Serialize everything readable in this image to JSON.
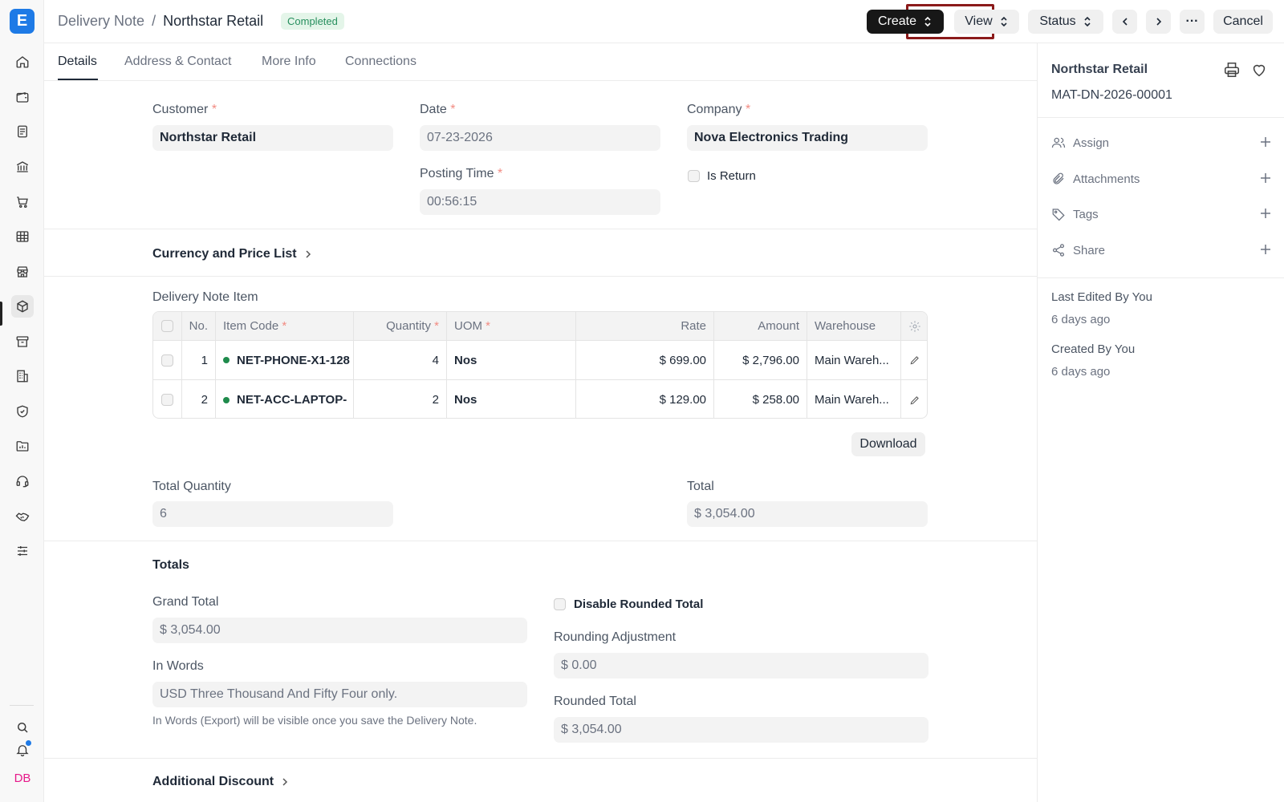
{
  "app": {
    "logo_letter": "E",
    "accent": "#1e7ae6",
    "user_initials": "DB"
  },
  "rail_icons": [
    "home-icon",
    "wallet-icon",
    "invoice-icon",
    "bank-icon",
    "cart-icon",
    "table-icon",
    "store-icon",
    "box-icon",
    "archive-icon",
    "building-icon",
    "shield-icon",
    "folder-chart-icon",
    "headset-icon",
    "handshake-icon",
    "sliders-icon",
    "search-icon",
    "bell-icon"
  ],
  "header": {
    "breadcrumb_parent": "Delivery Note",
    "breadcrumb_sep": "/",
    "breadcrumb_current": "Northstar Retail",
    "status_badge": "Completed",
    "create_label": "Create",
    "view_label": "View",
    "status_label": "Status",
    "more_label": "···",
    "cancel_label": "Cancel"
  },
  "tabs": [
    "Details",
    "Address & Contact",
    "More Info",
    "Connections"
  ],
  "form": {
    "customer_label": "Customer",
    "customer_value": "Northstar Retail",
    "date_label": "Date",
    "date_value": "07-23-2026",
    "company_label": "Company",
    "company_value": "Nova Electronics Trading",
    "posting_time_label": "Posting Time",
    "posting_time_value": "00:56:15",
    "is_return_label": "Is Return",
    "req_mark": "*"
  },
  "currency_section": {
    "title": "Currency and Price List"
  },
  "items_table": {
    "title": "Delivery Note Item",
    "headers": {
      "no": "No.",
      "item_code": "Item Code",
      "quantity": "Quantity",
      "uom": "UOM",
      "rate": "Rate",
      "amount": "Amount",
      "warehouse": "Warehouse"
    },
    "rows": [
      {
        "no": "1",
        "item_code": "NET-PHONE-X1-128",
        "quantity": "4",
        "uom": "Nos",
        "rate": "$ 699.00",
        "amount": "$ 2,796.00",
        "warehouse": "Main Wareh..."
      },
      {
        "no": "2",
        "item_code": "NET-ACC-LAPTOP-",
        "quantity": "2",
        "uom": "Nos",
        "rate": "$ 129.00",
        "amount": "$ 258.00",
        "warehouse": "Main Wareh..."
      }
    ],
    "download_label": "Download"
  },
  "summary": {
    "total_quantity_label": "Total Quantity",
    "total_quantity_value": "6",
    "total_label": "Total",
    "total_value": "$ 3,054.00"
  },
  "totals": {
    "title": "Totals",
    "grand_total_label": "Grand Total",
    "grand_total_value": "$ 3,054.00",
    "in_words_label": "In Words",
    "in_words_value": "USD Three Thousand And Fifty Four only.",
    "in_words_help": "In Words (Export) will be visible once you save the Delivery Note.",
    "disable_rounded_label": "Disable Rounded Total",
    "rounding_adj_label": "Rounding Adjustment",
    "rounding_adj_value": "$ 0.00",
    "rounded_total_label": "Rounded Total",
    "rounded_total_value": "$ 3,054.00"
  },
  "additional_discount": {
    "title": "Additional Discount"
  },
  "sidebar": {
    "title": "Northstar Retail",
    "doc_id": "MAT-DN-2026-00001",
    "actions": [
      "Assign",
      "Attachments",
      "Tags",
      "Share"
    ],
    "last_edited": "Last Edited By You",
    "last_edited_when": "6 days ago",
    "created": "Created By You",
    "created_when": "6 days ago"
  }
}
